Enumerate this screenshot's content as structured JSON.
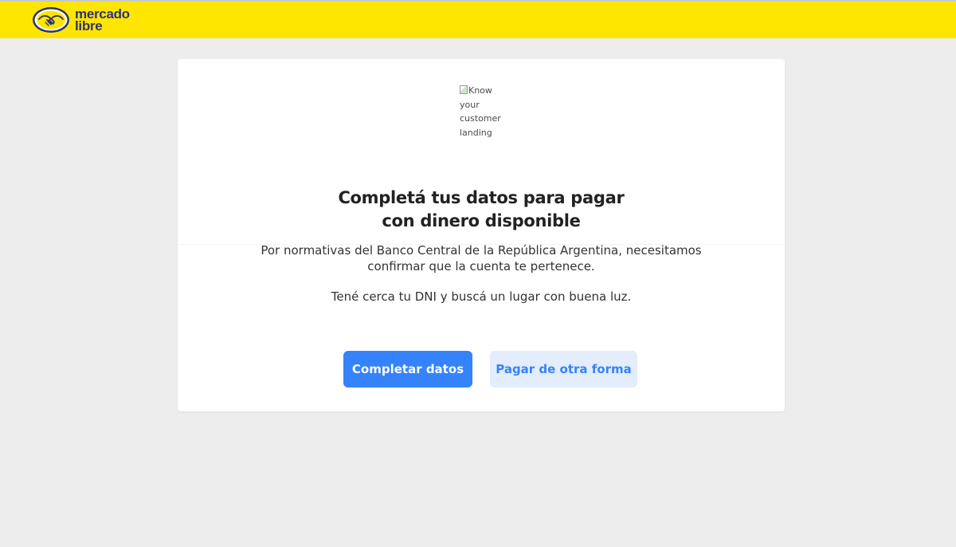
{
  "header": {
    "logo_line1": "mercado",
    "logo_line2": "libre",
    "brand_color": "#ffe600",
    "logo_text_color": "#2d3277"
  },
  "card": {
    "image_alt_lines": [
      "Know",
      "your",
      "customer",
      "landing"
    ],
    "title_line1": "Completá tus datos para pagar",
    "title_line2": "con dinero disponible",
    "description_line1": "Por normativas del Banco Central de la República Argentina, necesitamos",
    "description_line2": "confirmar que la cuenta te pertenece.",
    "hint": "Tené cerca tu DNI y buscá un lugar con buena luz.",
    "primary_button": "Completar datos",
    "secondary_button": "Pagar de otra forma",
    "primary_color": "#3483fa",
    "secondary_bg_color": "#e3edfb"
  },
  "icons": {
    "logo": "handshake-icon",
    "broken_image": "broken-image-icon"
  }
}
